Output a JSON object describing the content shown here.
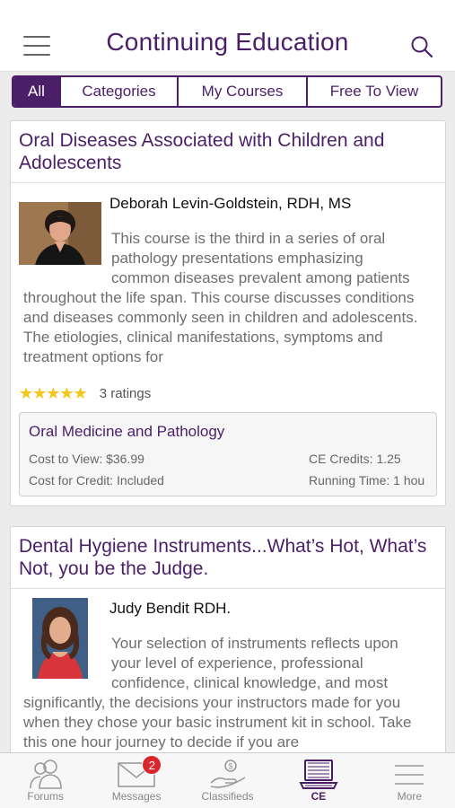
{
  "header": {
    "title": "Continuing Education"
  },
  "tabs": [
    {
      "label": "All",
      "active": true
    },
    {
      "label": "Categories",
      "active": false
    },
    {
      "label": "My Courses",
      "active": false
    },
    {
      "label": "Free To View",
      "active": false
    }
  ],
  "courses": [
    {
      "title": "Oral Diseases Associated with Children and Adolescents",
      "author": "Deborah Levin-Goldstein, RDH, MS",
      "description": "This course is the third in a series of oral pathology presentations emphasizing common diseases prevalent among patients throughout the life span. This course discusses conditions and diseases commonly seen in children and adolescents. The etiologies, clinical manifestations, symptoms and treatment options for",
      "stars": "★★★★★",
      "ratings": "3 ratings",
      "subject": "Oral Medicine and Pathology",
      "cost_to_view": "Cost to View: $36.99",
      "cost_for_credit": "Cost for Credit: Included",
      "ce_credits": "CE Credits: 1.25",
      "running_time": "Running Time: 1 hou"
    },
    {
      "title": "Dental Hygiene Instruments...What’s Hot, What’s Not, you be the Judge.",
      "author": "Judy Bendit RDH.",
      "description": "Your selection of instruments reflects upon your level of experience, professional confidence, clinical knowledge, and most significantly, the decisions your instructors made for you when they chose your basic instrument kit in school. Take this one hour journey to decide if you are"
    }
  ],
  "bottom_nav": [
    {
      "label": "Forums",
      "icon": "people-icon"
    },
    {
      "label": "Messages",
      "icon": "envelope-icon",
      "badge": "2"
    },
    {
      "label": "Classifieds",
      "icon": "hand-coin-icon"
    },
    {
      "label": "CE",
      "icon": "laptop-icon",
      "active": true
    },
    {
      "label": "More",
      "icon": "menu-lines-icon"
    }
  ],
  "colors": {
    "brand": "#4b1f68",
    "star": "#f5c518",
    "badge": "#d9262c"
  }
}
